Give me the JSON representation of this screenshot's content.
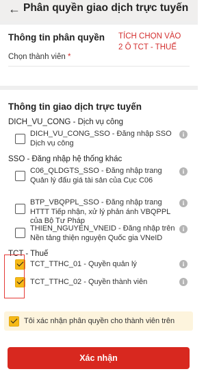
{
  "header": {
    "back_icon": "arrow-left-icon",
    "title": "Phân quyền giao dịch trực tuyến"
  },
  "permission_info": {
    "title": "Thông tin phân quyền",
    "note_line1": "TÍCH CHỌN VÀO",
    "note_line2": "2 Ô TCT - THUẾ",
    "member_label": "Chọn thành viên",
    "required_mark": "*"
  },
  "online_section": {
    "title": "Thông tin giao dịch trực tuyến",
    "groups": [
      {
        "name": "DICH_VU_CONG - Dịch vụ công",
        "items": [
          {
            "text": "DICH_VU_CONG_SSO - Đăng nhập SSO Dịch vụ công",
            "checked": false
          }
        ]
      },
      {
        "name": "SSO - Đăng nhập hệ thống khác",
        "items": [
          {
            "text": "C06_QLDGTS_SSO - Đăng nhập trang Quản lý đấu giá tài sản của Cục C06",
            "checked": false
          },
          {
            "text": "BTP_VBQPPL_SSO - Đăng nhập trang HTTT Tiếp nhận, xử lý phản ánh VBQPPL của Bộ Tư Pháp",
            "checked": false
          },
          {
            "text": "THIEN_NGUYEN_VNEID - Đăng nhập trên Nền tảng thiện nguyện Quốc gia VNeID",
            "checked": false
          }
        ]
      },
      {
        "name": "TCT - Thuế",
        "items": [
          {
            "text": "TCT_TTHC_01 - Quyền quản lý",
            "checked": true
          },
          {
            "text": "TCT_TTHC_02 - Quyền thành viên",
            "checked": true
          }
        ]
      }
    ]
  },
  "confirm": {
    "text": "Tôi xác nhận phân quyền cho thành viên trên",
    "checked": true
  },
  "submit_label": "Xác nhận",
  "colors": {
    "accent": "#d8281f",
    "checkbox": "#f6b917",
    "annotation": "#e53935"
  }
}
